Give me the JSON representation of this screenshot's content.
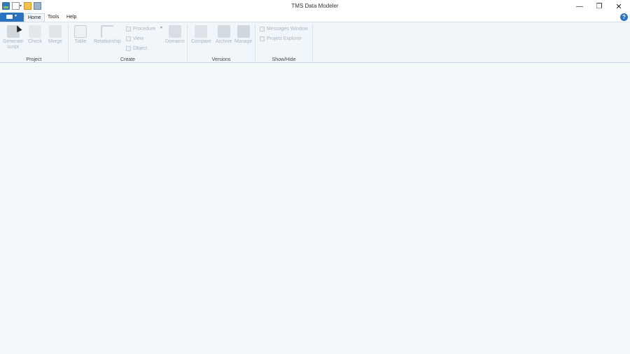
{
  "window": {
    "title": "TMS Data Modeler",
    "minimize_glyph": "—",
    "restore_glyph": "❐",
    "close_glyph": "✕"
  },
  "tabs": [
    {
      "label": "Home",
      "active": true
    },
    {
      "label": "Tools",
      "active": false
    },
    {
      "label": "Help",
      "active": false
    }
  ],
  "help_glyph": "?",
  "ribbon": {
    "project": {
      "label": "Project",
      "generate_script_line1": "Generate",
      "generate_script_line2": "script",
      "check": "Check",
      "merge": "Merge"
    },
    "create": {
      "label": "Create",
      "table": "Table",
      "relationship": "Relationship",
      "procedure": "Procedure",
      "view": "View",
      "object": "Object",
      "domains": "Domains"
    },
    "versions": {
      "label": "Versions",
      "compare": "Compare",
      "archive": "Archive",
      "manage": "Manage"
    },
    "showhide": {
      "label": "Show/Hide",
      "messages_window": "Messages Window",
      "project_explorer": "Project Explorer"
    }
  },
  "icons": [
    "app-icon",
    "new-file-icon",
    "open-folder-icon",
    "save-icon",
    "help-icon"
  ],
  "colors": {
    "accent": "#2b73c0",
    "background": "#f4f9fc"
  }
}
